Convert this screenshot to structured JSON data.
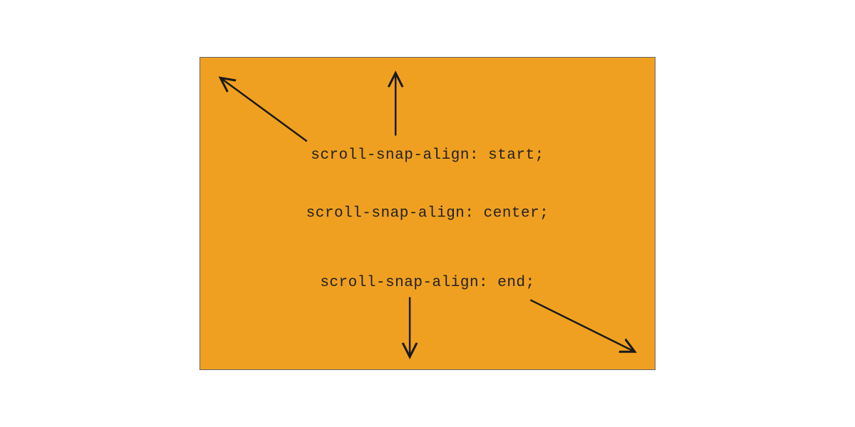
{
  "diagram": {
    "labels": {
      "start": "scroll-snap-align: start;",
      "center": "scroll-snap-align: center;",
      "end": "scroll-snap-align: end;"
    },
    "colors": {
      "background": "#f0a020",
      "stroke": "#1a1a1a"
    }
  }
}
